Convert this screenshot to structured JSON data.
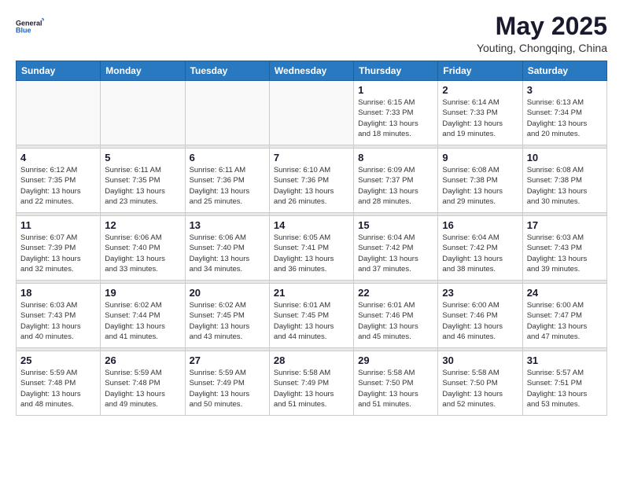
{
  "logo": {
    "general": "General",
    "blue": "Blue"
  },
  "title": "May 2025",
  "subtitle": "Youting, Chongqing, China",
  "days_header": [
    "Sunday",
    "Monday",
    "Tuesday",
    "Wednesday",
    "Thursday",
    "Friday",
    "Saturday"
  ],
  "weeks": [
    {
      "days": [
        {
          "num": "",
          "info": ""
        },
        {
          "num": "",
          "info": ""
        },
        {
          "num": "",
          "info": ""
        },
        {
          "num": "",
          "info": ""
        },
        {
          "num": "1",
          "info": "Sunrise: 6:15 AM\nSunset: 7:33 PM\nDaylight: 13 hours\nand 18 minutes."
        },
        {
          "num": "2",
          "info": "Sunrise: 6:14 AM\nSunset: 7:33 PM\nDaylight: 13 hours\nand 19 minutes."
        },
        {
          "num": "3",
          "info": "Sunrise: 6:13 AM\nSunset: 7:34 PM\nDaylight: 13 hours\nand 20 minutes."
        }
      ]
    },
    {
      "days": [
        {
          "num": "4",
          "info": "Sunrise: 6:12 AM\nSunset: 7:35 PM\nDaylight: 13 hours\nand 22 minutes."
        },
        {
          "num": "5",
          "info": "Sunrise: 6:11 AM\nSunset: 7:35 PM\nDaylight: 13 hours\nand 23 minutes."
        },
        {
          "num": "6",
          "info": "Sunrise: 6:11 AM\nSunset: 7:36 PM\nDaylight: 13 hours\nand 25 minutes."
        },
        {
          "num": "7",
          "info": "Sunrise: 6:10 AM\nSunset: 7:36 PM\nDaylight: 13 hours\nand 26 minutes."
        },
        {
          "num": "8",
          "info": "Sunrise: 6:09 AM\nSunset: 7:37 PM\nDaylight: 13 hours\nand 28 minutes."
        },
        {
          "num": "9",
          "info": "Sunrise: 6:08 AM\nSunset: 7:38 PM\nDaylight: 13 hours\nand 29 minutes."
        },
        {
          "num": "10",
          "info": "Sunrise: 6:08 AM\nSunset: 7:38 PM\nDaylight: 13 hours\nand 30 minutes."
        }
      ]
    },
    {
      "days": [
        {
          "num": "11",
          "info": "Sunrise: 6:07 AM\nSunset: 7:39 PM\nDaylight: 13 hours\nand 32 minutes."
        },
        {
          "num": "12",
          "info": "Sunrise: 6:06 AM\nSunset: 7:40 PM\nDaylight: 13 hours\nand 33 minutes."
        },
        {
          "num": "13",
          "info": "Sunrise: 6:06 AM\nSunset: 7:40 PM\nDaylight: 13 hours\nand 34 minutes."
        },
        {
          "num": "14",
          "info": "Sunrise: 6:05 AM\nSunset: 7:41 PM\nDaylight: 13 hours\nand 36 minutes."
        },
        {
          "num": "15",
          "info": "Sunrise: 6:04 AM\nSunset: 7:42 PM\nDaylight: 13 hours\nand 37 minutes."
        },
        {
          "num": "16",
          "info": "Sunrise: 6:04 AM\nSunset: 7:42 PM\nDaylight: 13 hours\nand 38 minutes."
        },
        {
          "num": "17",
          "info": "Sunrise: 6:03 AM\nSunset: 7:43 PM\nDaylight: 13 hours\nand 39 minutes."
        }
      ]
    },
    {
      "days": [
        {
          "num": "18",
          "info": "Sunrise: 6:03 AM\nSunset: 7:43 PM\nDaylight: 13 hours\nand 40 minutes."
        },
        {
          "num": "19",
          "info": "Sunrise: 6:02 AM\nSunset: 7:44 PM\nDaylight: 13 hours\nand 41 minutes."
        },
        {
          "num": "20",
          "info": "Sunrise: 6:02 AM\nSunset: 7:45 PM\nDaylight: 13 hours\nand 43 minutes."
        },
        {
          "num": "21",
          "info": "Sunrise: 6:01 AM\nSunset: 7:45 PM\nDaylight: 13 hours\nand 44 minutes."
        },
        {
          "num": "22",
          "info": "Sunrise: 6:01 AM\nSunset: 7:46 PM\nDaylight: 13 hours\nand 45 minutes."
        },
        {
          "num": "23",
          "info": "Sunrise: 6:00 AM\nSunset: 7:46 PM\nDaylight: 13 hours\nand 46 minutes."
        },
        {
          "num": "24",
          "info": "Sunrise: 6:00 AM\nSunset: 7:47 PM\nDaylight: 13 hours\nand 47 minutes."
        }
      ]
    },
    {
      "days": [
        {
          "num": "25",
          "info": "Sunrise: 5:59 AM\nSunset: 7:48 PM\nDaylight: 13 hours\nand 48 minutes."
        },
        {
          "num": "26",
          "info": "Sunrise: 5:59 AM\nSunset: 7:48 PM\nDaylight: 13 hours\nand 49 minutes."
        },
        {
          "num": "27",
          "info": "Sunrise: 5:59 AM\nSunset: 7:49 PM\nDaylight: 13 hours\nand 50 minutes."
        },
        {
          "num": "28",
          "info": "Sunrise: 5:58 AM\nSunset: 7:49 PM\nDaylight: 13 hours\nand 51 minutes."
        },
        {
          "num": "29",
          "info": "Sunrise: 5:58 AM\nSunset: 7:50 PM\nDaylight: 13 hours\nand 51 minutes."
        },
        {
          "num": "30",
          "info": "Sunrise: 5:58 AM\nSunset: 7:50 PM\nDaylight: 13 hours\nand 52 minutes."
        },
        {
          "num": "31",
          "info": "Sunrise: 5:57 AM\nSunset: 7:51 PM\nDaylight: 13 hours\nand 53 minutes."
        }
      ]
    }
  ]
}
